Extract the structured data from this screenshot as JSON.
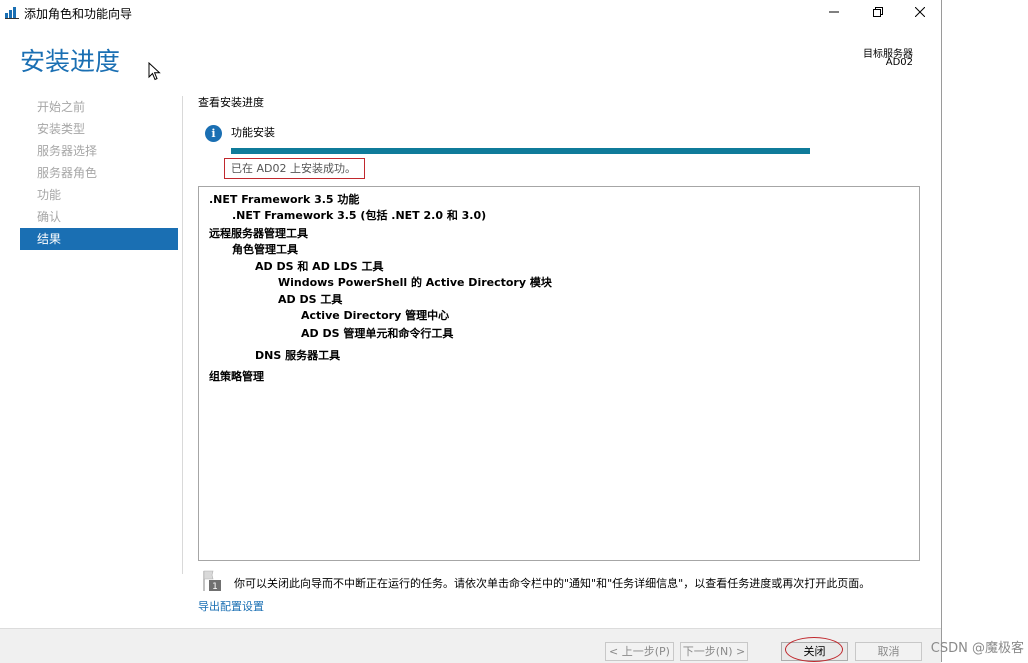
{
  "window": {
    "title": "添加角色和功能向导"
  },
  "header": {
    "title": "安装进度",
    "target_label": "目标服务器",
    "target_value": "AD02"
  },
  "sidebar": {
    "items": [
      {
        "label": "开始之前"
      },
      {
        "label": "安装类型"
      },
      {
        "label": "服务器选择"
      },
      {
        "label": "服务器角色"
      },
      {
        "label": "功能"
      },
      {
        "label": "确认"
      },
      {
        "label": "结果"
      }
    ],
    "active_index": 6
  },
  "main": {
    "section_title": "查看安装进度",
    "status_label": "功能安装",
    "progress": 1.0,
    "success_message": "已在 AD02 上安装成功。",
    "results": [
      {
        "text": ".NET Framework 3.5 功能",
        "level": 0
      },
      {
        "text": ".NET Framework 3.5 (包括 .NET 2.0 和 3.0)",
        "level": 1
      },
      {
        "text": "远程服务器管理工具",
        "level": 0
      },
      {
        "text": "角色管理工具",
        "level": 1
      },
      {
        "text": "AD DS 和 AD LDS 工具",
        "level": 2
      },
      {
        "text": "Windows PowerShell 的 Active Directory 模块",
        "level": 3
      },
      {
        "text": "AD DS 工具",
        "level": 3
      },
      {
        "text": "Active Directory 管理中心",
        "level": 4
      },
      {
        "text": "AD DS 管理单元和命令行工具",
        "level": 4
      },
      {
        "text": "DNS 服务器工具",
        "level": 2
      },
      {
        "text": "组策略管理",
        "level": 0
      }
    ],
    "note": "你可以关闭此向导而不中断正在运行的任务。请依次单击命令栏中的\"通知\"和\"任务详细信息\"，以查看任务进度或再次打开此页面。",
    "note_icon_number": "1",
    "export_link": "导出配置设置"
  },
  "footer": {
    "prev": "< 上一步(P)",
    "next": "下一步(N) >",
    "close": "关闭",
    "cancel": "取消"
  },
  "watermark": "CSDN @魔极客",
  "colors": {
    "accent": "#1a6fb3",
    "progress": "#0f7b9a",
    "highlight": "#c0282d"
  }
}
